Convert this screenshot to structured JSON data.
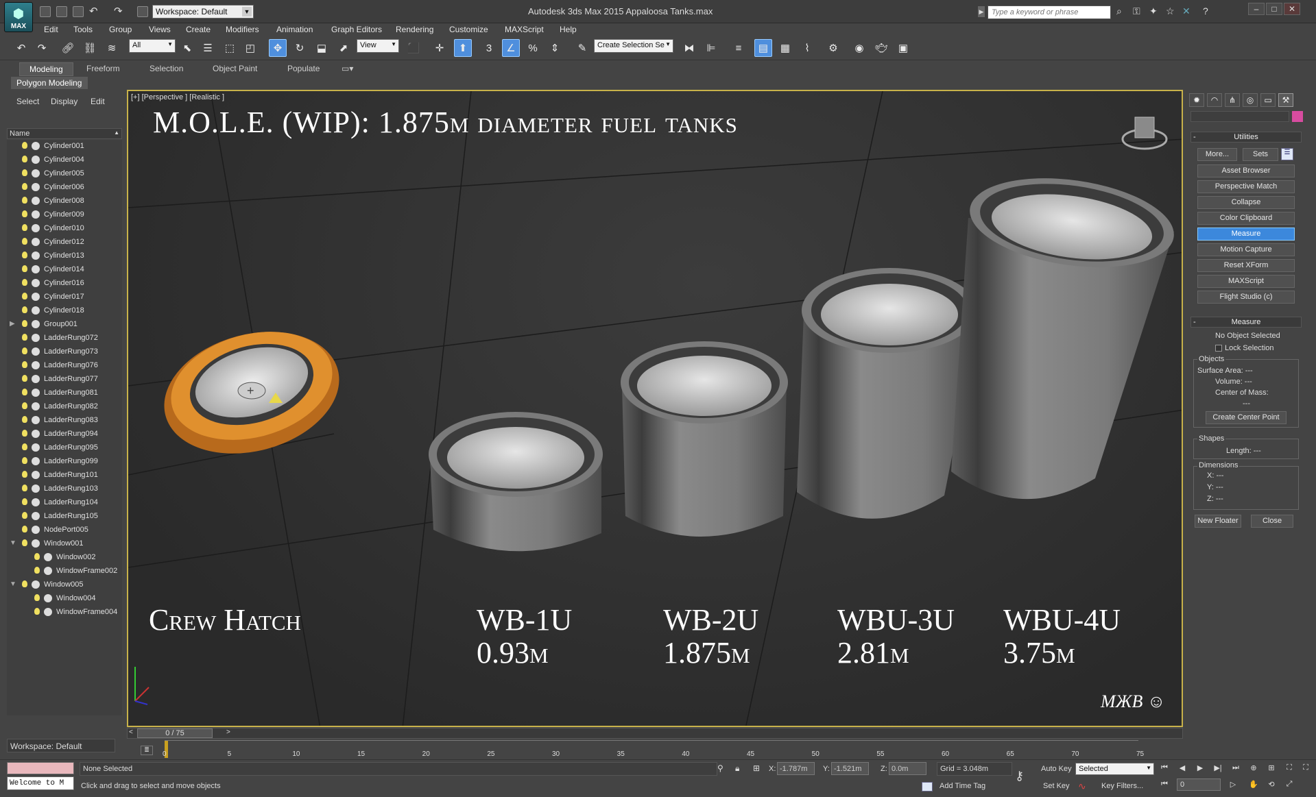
{
  "titlebar": {
    "logo": "MAX",
    "workspace": "Workspace: Default",
    "title": "Autodesk 3ds Max  2015    Appaloosa Tanks.max",
    "search_placeholder": "Type a keyword or phrase"
  },
  "menubar": [
    "Edit",
    "Tools",
    "Group",
    "Views",
    "Create",
    "Modifiers",
    "Animation",
    "Graph Editors",
    "Rendering",
    "Customize",
    "MAXScript",
    "Help"
  ],
  "toolbar": {
    "filter": "All",
    "view": "View",
    "selection_set": "Create Selection Se"
  },
  "ribbon": {
    "tabs": [
      "Modeling",
      "Freeform",
      "Selection",
      "Object Paint",
      "Populate"
    ],
    "active": "Modeling",
    "panel": "Polygon Modeling"
  },
  "explorer": {
    "menu": [
      "Select",
      "Display",
      "Edit"
    ],
    "column": "Name",
    "items": [
      {
        "name": "Cylinder001",
        "indent": 0,
        "exp": ""
      },
      {
        "name": "Cylinder004",
        "indent": 0,
        "exp": ""
      },
      {
        "name": "Cylinder005",
        "indent": 0,
        "exp": ""
      },
      {
        "name": "Cylinder006",
        "indent": 0,
        "exp": ""
      },
      {
        "name": "Cylinder008",
        "indent": 0,
        "exp": ""
      },
      {
        "name": "Cylinder009",
        "indent": 0,
        "exp": ""
      },
      {
        "name": "Cylinder010",
        "indent": 0,
        "exp": ""
      },
      {
        "name": "Cylinder012",
        "indent": 0,
        "exp": ""
      },
      {
        "name": "Cylinder013",
        "indent": 0,
        "exp": ""
      },
      {
        "name": "Cylinder014",
        "indent": 0,
        "exp": ""
      },
      {
        "name": "Cylinder016",
        "indent": 0,
        "exp": ""
      },
      {
        "name": "Cylinder017",
        "indent": 0,
        "exp": ""
      },
      {
        "name": "Cylinder018",
        "indent": 0,
        "exp": ""
      },
      {
        "name": "Group001",
        "indent": 0,
        "exp": "▶"
      },
      {
        "name": "LadderRung072",
        "indent": 0,
        "exp": ""
      },
      {
        "name": "LadderRung073",
        "indent": 0,
        "exp": ""
      },
      {
        "name": "LadderRung076",
        "indent": 0,
        "exp": ""
      },
      {
        "name": "LadderRung077",
        "indent": 0,
        "exp": ""
      },
      {
        "name": "LadderRung081",
        "indent": 0,
        "exp": ""
      },
      {
        "name": "LadderRung082",
        "indent": 0,
        "exp": ""
      },
      {
        "name": "LadderRung083",
        "indent": 0,
        "exp": ""
      },
      {
        "name": "LadderRung094",
        "indent": 0,
        "exp": ""
      },
      {
        "name": "LadderRung095",
        "indent": 0,
        "exp": ""
      },
      {
        "name": "LadderRung099",
        "indent": 0,
        "exp": ""
      },
      {
        "name": "LadderRung101",
        "indent": 0,
        "exp": ""
      },
      {
        "name": "LadderRung103",
        "indent": 0,
        "exp": ""
      },
      {
        "name": "LadderRung104",
        "indent": 0,
        "exp": ""
      },
      {
        "name": "LadderRung105",
        "indent": 0,
        "exp": ""
      },
      {
        "name": "NodePort005",
        "indent": 0,
        "exp": ""
      },
      {
        "name": "Window001",
        "indent": 0,
        "exp": "▼"
      },
      {
        "name": "Window002",
        "indent": 1,
        "exp": ""
      },
      {
        "name": "WindowFrame002",
        "indent": 1,
        "exp": ""
      },
      {
        "name": "Window005",
        "indent": 0,
        "exp": "▼"
      },
      {
        "name": "Window004",
        "indent": 1,
        "exp": ""
      },
      {
        "name": "WindowFrame004",
        "indent": 1,
        "exp": ""
      }
    ],
    "workspace": "Workspace: Default"
  },
  "viewport": {
    "label": "[+] [Perspective ] [Realistic ]",
    "title": "M.O.L.E. (WIP): 1.875m diameter fuel tanks",
    "captions": [
      {
        "name": "Crew Hatch",
        "size": ""
      },
      {
        "name": "WB-1U",
        "size": "0.93m"
      },
      {
        "name": "WB-2U",
        "size": "1.875m"
      },
      {
        "name": "WBU-3U",
        "size": "2.81m"
      },
      {
        "name": "WBU-4U",
        "size": "3.75m"
      }
    ],
    "signature": "MЖB ☺"
  },
  "timeline": {
    "slider": "0 / 75",
    "ticks": [
      "0",
      "5",
      "10",
      "15",
      "20",
      "25",
      "30",
      "35",
      "40",
      "45",
      "50",
      "55",
      "60",
      "65",
      "70",
      "75"
    ]
  },
  "command_panel": {
    "utilities_title": "Utilities",
    "more": "More...",
    "sets": "Sets",
    "buttons": [
      "Asset Browser",
      "Perspective Match",
      "Collapse",
      "Color Clipboard",
      "Measure",
      "Motion Capture",
      "Reset XForm",
      "MAXScript",
      "Flight Studio (c)"
    ],
    "active_button": "Measure",
    "measure": {
      "title": "Measure",
      "no_selection": "No Object Selected",
      "lock": "Lock Selection",
      "objects_group": "Objects",
      "surface_area": "Surface Area:  ---",
      "volume": "Volume:  ---",
      "center_of_mass": "Center of Mass:",
      "com_value": "---",
      "create_center": "Create Center Point",
      "shapes_group": "Shapes",
      "length": "Length:  ---",
      "dimensions_group": "Dimensions",
      "x": "X:   ---",
      "y": "Y:   ---",
      "z": "Z:   ---",
      "new_floater": "New Floater",
      "close": "Close"
    }
  },
  "status": {
    "maxscript": "Welcome to M",
    "selection": "None Selected",
    "prompt": "Click and drag to select and move objects",
    "x_label": "X:",
    "x": "-1.787m",
    "y_label": "Y:",
    "y": "-1.521m",
    "z_label": "Z:",
    "z": "0.0m",
    "grid": "Grid = 3.048m",
    "add_time_tag": "Add Time Tag",
    "auto_key": "Auto Key",
    "set_key": "Set Key",
    "selected": "Selected",
    "key_filters": "Key Filters...",
    "frame": "0"
  }
}
